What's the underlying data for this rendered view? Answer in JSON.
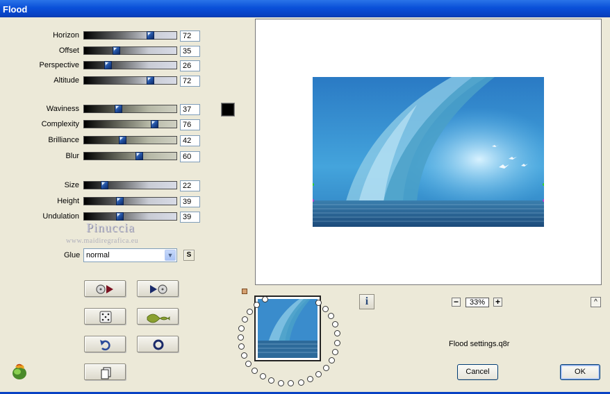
{
  "window": {
    "title": "Flood"
  },
  "sliders": [
    {
      "label": "Horizon",
      "value": "72",
      "level": 72
    },
    {
      "label": "Offset",
      "value": "35",
      "level": 35
    },
    {
      "label": "Perspective",
      "value": "26",
      "level": 26
    },
    {
      "label": "Altitude",
      "value": "72",
      "level": 72
    },
    {
      "label": "Waviness",
      "value": "37",
      "level": 37
    },
    {
      "label": "Complexity",
      "value": "76",
      "level": 76
    },
    {
      "label": "Brilliance",
      "value": "42",
      "level": 42
    },
    {
      "label": "Blur",
      "value": "60",
      "level": 60
    },
    {
      "label": "Size",
      "value": "22",
      "level": 22
    },
    {
      "label": "Height",
      "value": "39",
      "level": 39
    },
    {
      "label": "Undulation",
      "value": "39",
      "level": 39
    }
  ],
  "color_swatch": "#000000",
  "watermark": {
    "name": "Pinuccia",
    "url": "www.maidiregrafica.eu"
  },
  "glue": {
    "label": "Glue",
    "value": "normal",
    "s_button": "S"
  },
  "preview": {
    "zoom": "33%",
    "minus": "−",
    "plus": "+",
    "info": "i",
    "collapse": "^"
  },
  "settings_file": "Flood settings.q8r",
  "buttons": {
    "cancel": "Cancel",
    "ok": "OK"
  },
  "icons": {
    "tool_buttons": [
      "film-reset-icon",
      "film-play-icon",
      "random-dice-icon",
      "wave-icon",
      "undo-icon",
      "circle-icon",
      "copy-icon"
    ]
  }
}
